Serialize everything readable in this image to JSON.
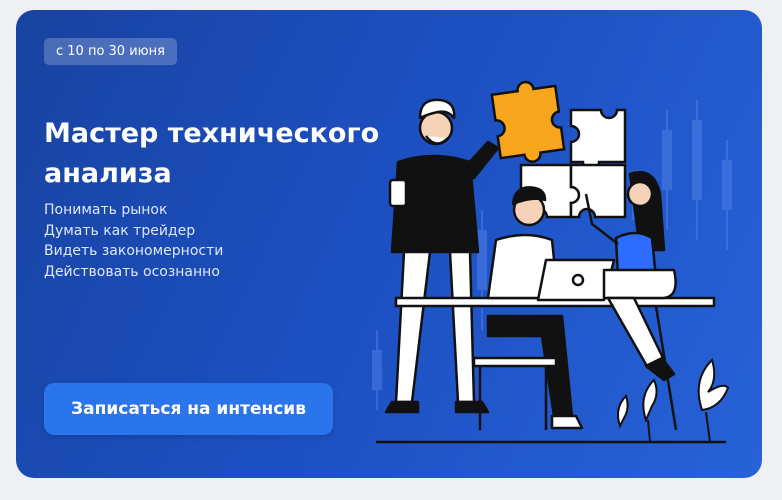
{
  "promo": {
    "date_badge": "с 10 по 30 июня",
    "title": "Мастер технического анализа",
    "features": [
      "Понимать рынок",
      "Думать как трейдер",
      "Видеть закономерности",
      "Действовать осознанно"
    ],
    "cta_label": "Записаться на интенсив"
  },
  "colors": {
    "banner_start": "#1843a0",
    "banner_end": "#2762d8",
    "cta": "#2a74ec",
    "puzzle_orange": "#f7a51c",
    "accent_blue": "#2d6cff"
  },
  "icons": {
    "illustration": "team-solving-puzzle-illustration"
  }
}
